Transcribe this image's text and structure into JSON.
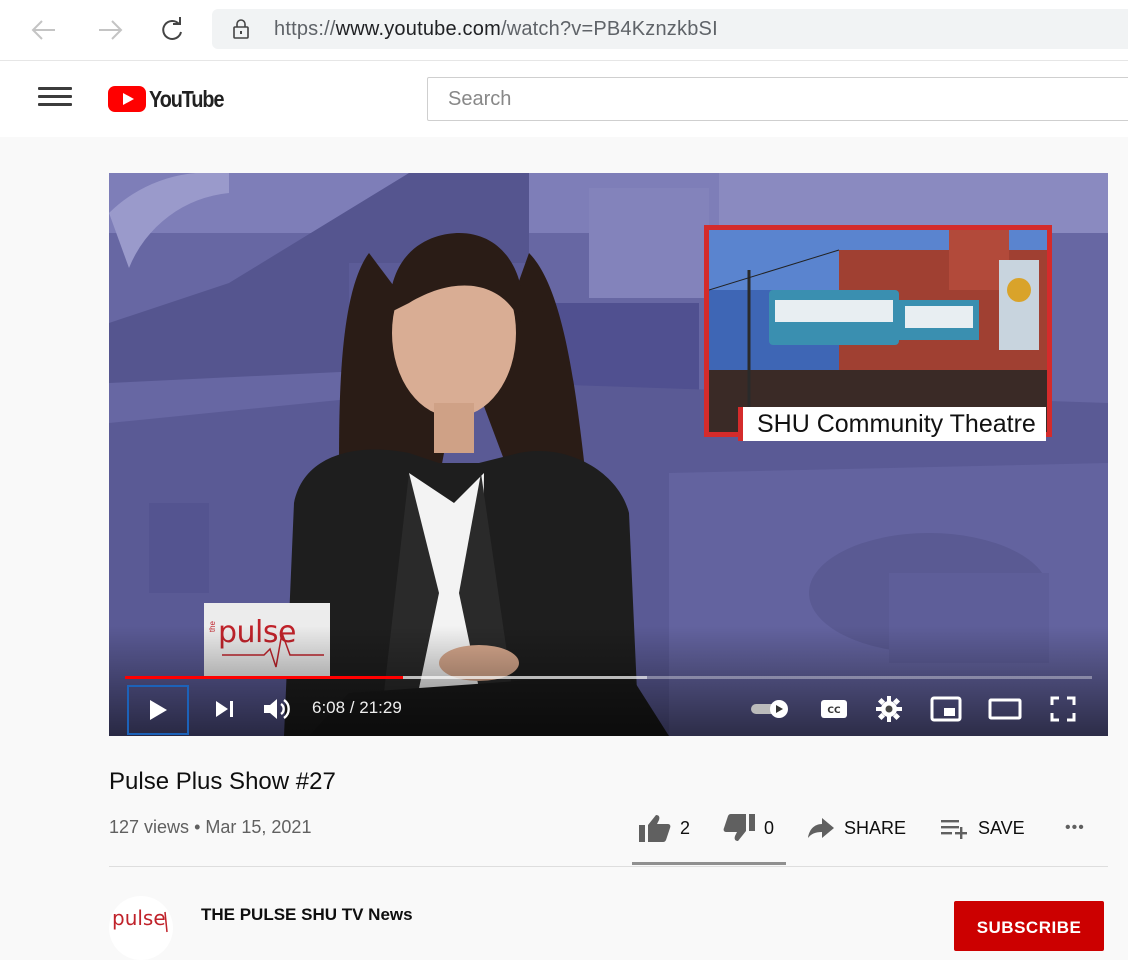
{
  "browser": {
    "url_scheme": "https://",
    "url_domain": "www.youtube.com",
    "url_path": "/watch?v=PB4KznzkbSI"
  },
  "header": {
    "logo_text": "YouTube",
    "search_placeholder": "Search"
  },
  "player": {
    "lower_third": "SHU Community Theatre",
    "show_logo_text": "pulse",
    "show_logo_prefix": "the",
    "time_display": "6:08 / 21:29",
    "progress_played": 0.287,
    "progress_buffered": 0.54,
    "colors": {
      "progress": "#ff0000",
      "frame_accent": "#d42b2b"
    }
  },
  "video": {
    "title": "Pulse Plus Show #27",
    "views": "127 views",
    "separator": "•",
    "date": "Mar 15, 2021",
    "likes": "2",
    "dislikes": "0",
    "share_label": "SHARE",
    "save_label": "SAVE",
    "more_label": "•••"
  },
  "channel": {
    "name": "THE PULSE SHU TV News",
    "avatar_text": "pulse",
    "subscribe_label": "SUBSCRIBE"
  },
  "icons": [
    "back-arrow-icon",
    "forward-arrow-icon",
    "reload-icon",
    "lock-icon",
    "menu-icon",
    "play-icon",
    "next-icon",
    "volume-icon",
    "autoplay-toggle-icon",
    "captions-icon",
    "settings-icon",
    "miniplayer-icon",
    "theater-icon",
    "fullscreen-icon",
    "thumbs-up-icon",
    "thumbs-down-icon",
    "share-icon",
    "save-icon"
  ]
}
